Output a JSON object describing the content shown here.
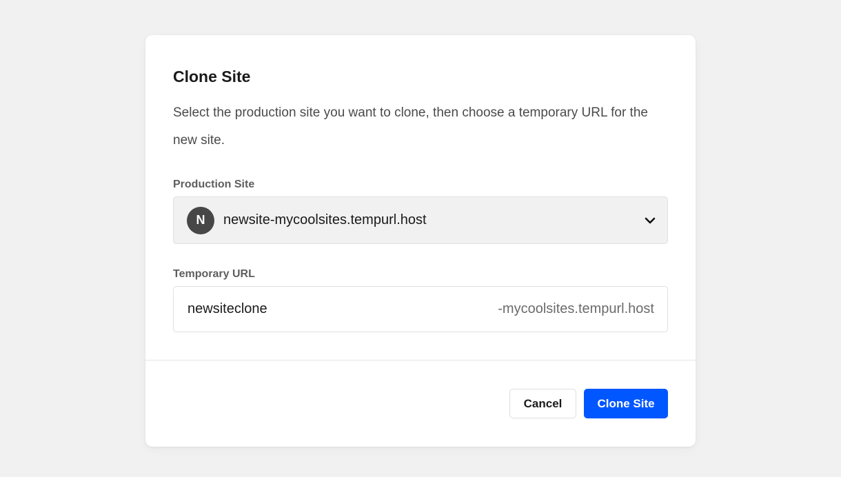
{
  "modal": {
    "title": "Clone Site",
    "description": "Select the production site you want to clone, then choose a temporary URL for the new site."
  },
  "production_site": {
    "label": "Production Site",
    "avatar_letter": "N",
    "selected_value": "newsite-mycoolsites.tempurl.host",
    "icon": "chevron-down-icon"
  },
  "temporary_url": {
    "label": "Temporary URL",
    "value": "newsiteclone",
    "suffix": "-mycoolsites.tempurl.host"
  },
  "footer": {
    "cancel_label": "Cancel",
    "submit_label": "Clone Site"
  },
  "colors": {
    "background": "#f1f1f1",
    "primary": "#0057ff",
    "avatar": "#474747"
  }
}
